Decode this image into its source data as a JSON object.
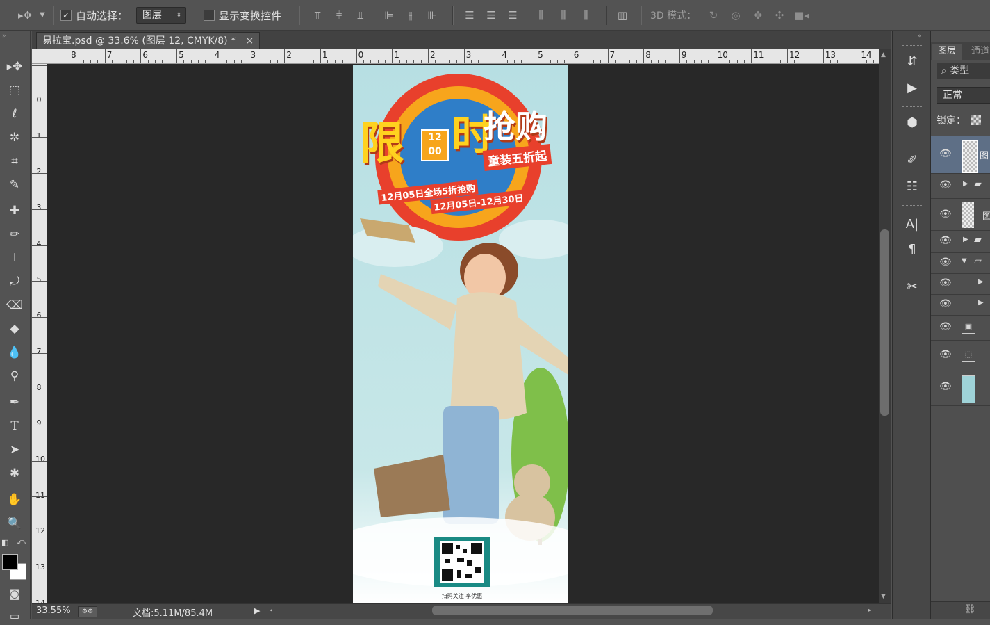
{
  "options_bar": {
    "auto_select_label": "自动选择：",
    "auto_select_value": "图层",
    "show_transform_label": "显示变换控件",
    "mode_3d_label": "3D 模式："
  },
  "document": {
    "tab_title": "易拉宝.psd @ 33.6% (图层 12, CMYK/8) *",
    "close_glyph": "×"
  },
  "ruler": {
    "top_labels": [
      "8",
      "7",
      "6",
      "5",
      "4",
      "3",
      "2",
      "1",
      "0",
      "1",
      "2",
      "3",
      "4",
      "5",
      "6",
      "7",
      "8",
      "9",
      "10",
      "11",
      "12",
      "13",
      "14"
    ],
    "left_labels": [
      "0",
      "1",
      "2",
      "3",
      "4",
      "5",
      "6",
      "7",
      "8",
      "9",
      "10",
      "11",
      "12",
      "13",
      "14"
    ]
  },
  "status": {
    "zoom": "33.55%",
    "doc_info": "文档:5.11M/85.4M"
  },
  "poster": {
    "headline_a": "限",
    "headline_b": "时",
    "headline_c": "抢购",
    "clock_top": "12",
    "clock_bottom": "00",
    "subline": "童装五折起",
    "date_line_1": "12月05日全场5折抢购",
    "date_line_2": "12月05日-12月30日",
    "qr_caption": "扫码关注 享优惠"
  },
  "layers_panel": {
    "tab_layers": "图层",
    "tab_channels": "通道",
    "filter_label": "类型",
    "blend_mode": "正常",
    "lock_label": "锁定："
  },
  "colors": {
    "poster_bg": "#b9e1e4",
    "headline_yellow": "#ffd21f",
    "ring_red": "#e8402c",
    "ring_orange": "#f7a51c",
    "ring_blue": "#2f7ec8"
  }
}
